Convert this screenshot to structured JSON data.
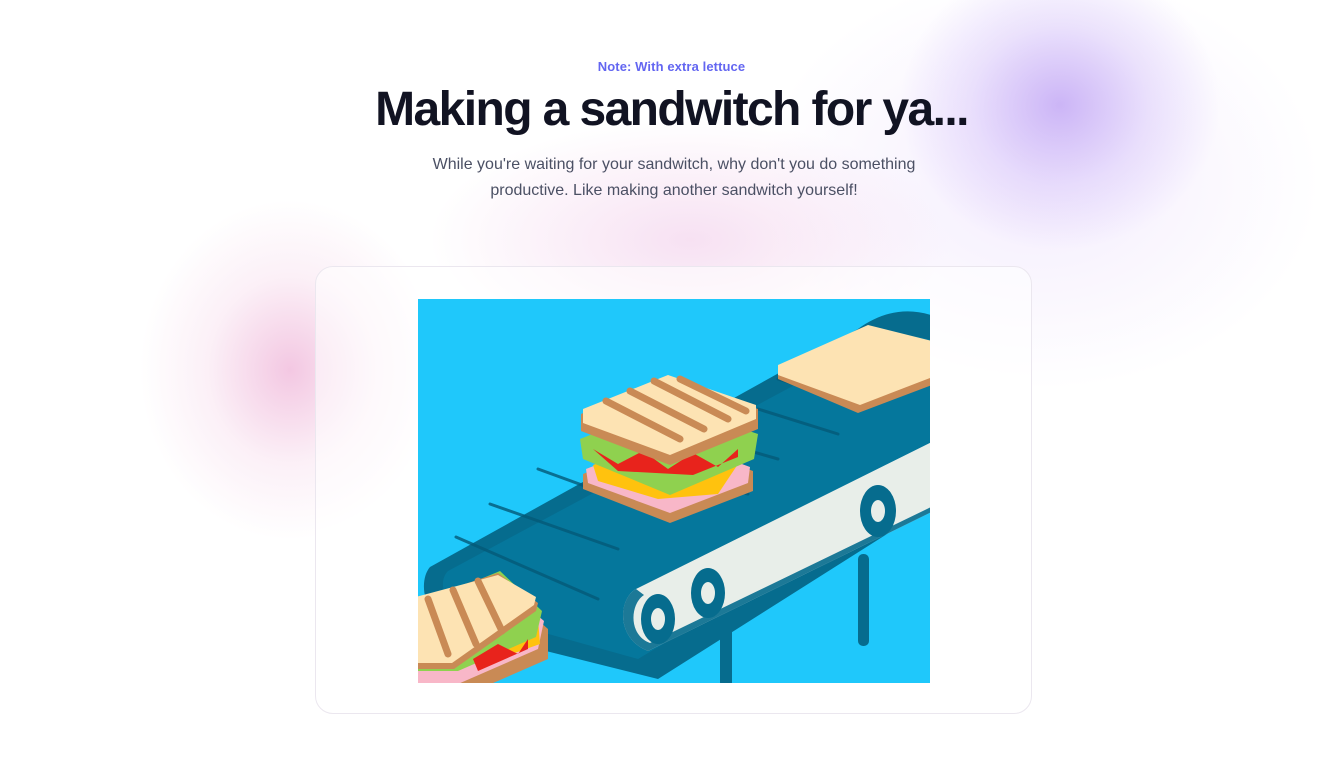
{
  "header": {
    "note": "Note: With extra lettuce",
    "title": "Making a sandwitch for ya...",
    "subtitle": "While you're waiting for your sandwitch, why don't you do something productive. Like making another sandwitch yourself!"
  },
  "illustration": {
    "subject": "sandwich-conveyor-belt-illustration",
    "background_color": "#1fc8fb",
    "belt_color": "#066c8e",
    "frame_color": "#e8eee9"
  }
}
